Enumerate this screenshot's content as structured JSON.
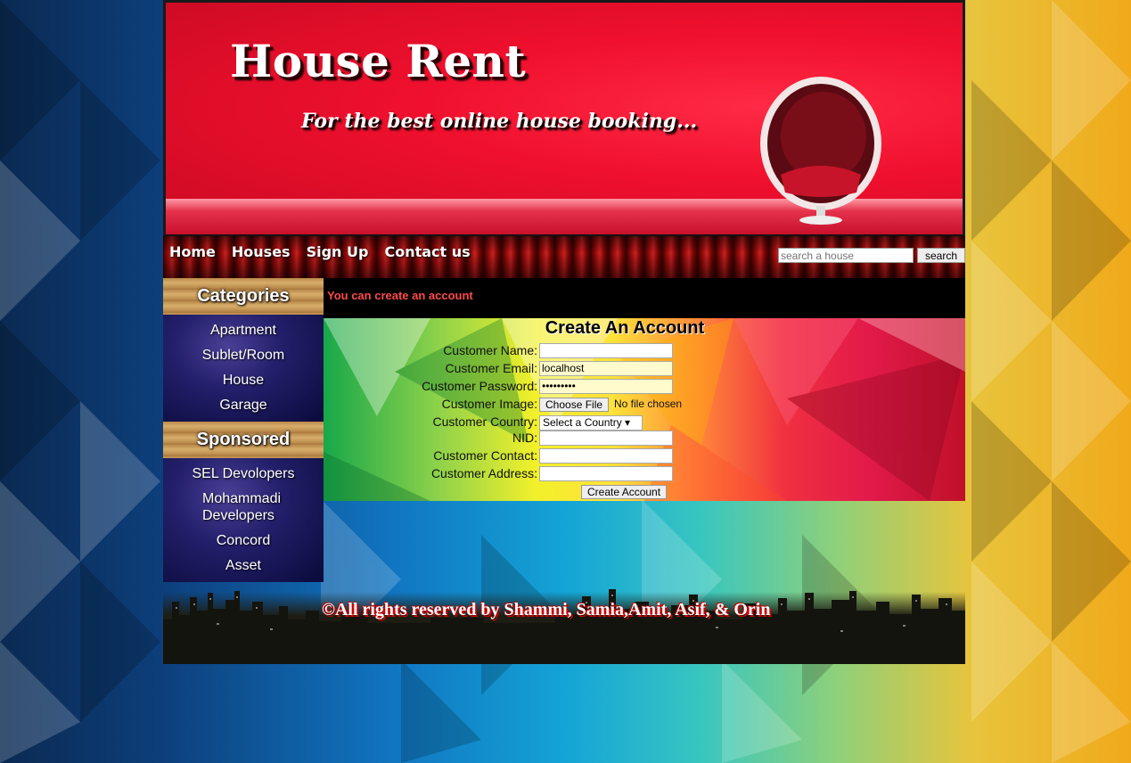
{
  "header": {
    "title": "House Rent",
    "tagline": "For the best online house booking..."
  },
  "nav": {
    "links": [
      "Home",
      "Houses",
      "Sign Up",
      "Contact us"
    ],
    "search_placeholder": "search a house",
    "search_button": "search"
  },
  "sidebar": {
    "categories_title": "Categories",
    "categories": [
      "Apartment",
      "Sublet/Room",
      "House",
      "Garage"
    ],
    "sponsored_title": "Sponsored",
    "sponsors": [
      "SEL Devolopers",
      "Mohammadi Developers",
      "Concord",
      "Asset"
    ]
  },
  "notice": "You can create an account",
  "form": {
    "title": "Create An Account",
    "fields": {
      "name": {
        "label": "Customer Name:",
        "value": ""
      },
      "email": {
        "label": "Customer Email:",
        "value": "localhost"
      },
      "password": {
        "label": "Customer Password:",
        "value": "•••••••••"
      },
      "image": {
        "label": "Customer Image:",
        "button": "Choose File",
        "status": "No file chosen"
      },
      "country": {
        "label": "Customer Country:",
        "value": "Select a Country ▾"
      },
      "nid": {
        "label": "NID:",
        "value": ""
      },
      "contact": {
        "label": "Customer Contact:",
        "value": ""
      },
      "address": {
        "label": "Customer Address:",
        "value": ""
      }
    },
    "submit": "Create Account"
  },
  "footer": {
    "text": "©All rights reserved by Shammi, Samia,Amit, Asif, & Orin"
  },
  "colors": {
    "header_red": "#f0102e",
    "notice_text": "#ff4a4a",
    "input_fill": "#fffbcc"
  }
}
